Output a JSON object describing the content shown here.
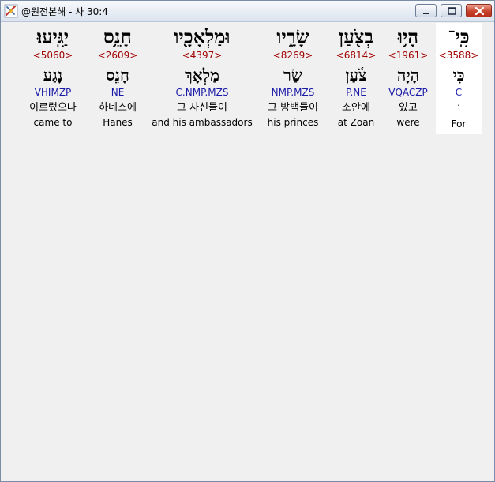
{
  "window": {
    "title": "@원전본해 - 사 30:4"
  },
  "words": [
    {
      "hebrew": "כִּֽי־",
      "strong": "<3588>",
      "lemma": "כִּי",
      "morph": "C",
      "korean": ".",
      "english": "For",
      "selected": true
    },
    {
      "hebrew": "הָי֥וּ",
      "strong": "<1961>",
      "lemma": "הָיָה",
      "morph": "VQACZP",
      "korean": "있고",
      "english": "were",
      "selected": false
    },
    {
      "hebrew": "בְצֹ֖עַן",
      "strong": "<6814>",
      "lemma": "צֹ֫עַן",
      "morph": "P.NE",
      "korean": "소안에",
      "english": "at Zoan",
      "selected": false
    },
    {
      "hebrew": "שָׂרָ֑יו",
      "strong": "<8269>",
      "lemma": "שַׂר",
      "morph": "NMP.MZS",
      "korean": "그 방백들이",
      "english": "his princes",
      "selected": false
    },
    {
      "hebrew": "וּמַלְאָכָ֖יו",
      "strong": "<4397>",
      "lemma": "מַלְאָךְ",
      "morph": "C.NMP.MZS",
      "korean": "그 사신들이",
      "english": "and his ambassadors",
      "selected": false
    },
    {
      "hebrew": "חָנֵ֥ס",
      "strong": "<2609>",
      "lemma": "חָנֵס",
      "morph": "NE",
      "korean": "하네스에",
      "english": "Hanes",
      "selected": false
    },
    {
      "hebrew": "יַגִּֽיעוּ׃",
      "strong": "<5060>",
      "lemma": "נָגַע",
      "morph": "VHIMZP",
      "korean": "이르렀으나",
      "english": "came to",
      "selected": false
    }
  ]
}
